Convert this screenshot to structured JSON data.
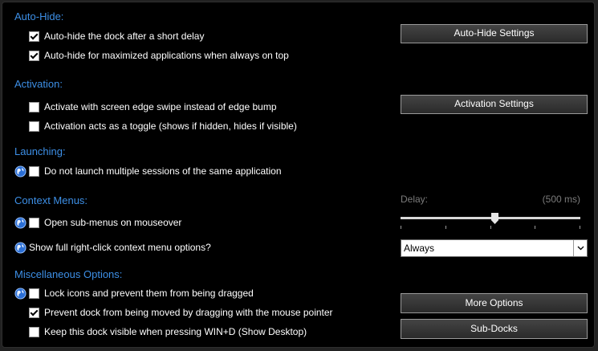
{
  "colors": {
    "accent": "#3d8fe6",
    "background": "#000000"
  },
  "autohide": {
    "title": "Auto-Hide:",
    "options": [
      {
        "label": "Auto-hide the dock after a short delay",
        "checked": true
      },
      {
        "label": "Auto-hide for maximized applications when always on top",
        "checked": true
      }
    ],
    "button": "Auto-Hide Settings"
  },
  "activation": {
    "title": "Activation:",
    "options": [
      {
        "label": "Activate with screen edge swipe instead of edge bump",
        "checked": false
      },
      {
        "label": "Activation acts as a toggle (shows if hidden, hides if visible)",
        "checked": false
      }
    ],
    "button": "Activation Settings"
  },
  "launching": {
    "title": "Launching:",
    "options": [
      {
        "label": "Do not launch multiple sessions of the same application",
        "checked": false,
        "icon": "globe-icon"
      }
    ]
  },
  "context": {
    "title": "Context Menus:",
    "options": [
      {
        "label": "Open sub-menus on mouseover",
        "checked": false,
        "icon": "globe-icon"
      }
    ],
    "show_full_label": "Show full right-click context menu options?",
    "delay_label": "Delay:",
    "delay_value": "(500 ms)",
    "slider_fraction": 0.5,
    "dropdown_value": "Always"
  },
  "misc": {
    "title": "Miscellaneous Options:",
    "options": [
      {
        "label": "Lock icons and prevent them from being dragged",
        "checked": false,
        "icon": "globe-icon"
      },
      {
        "label": "Prevent dock from being moved by dragging with the mouse pointer",
        "checked": true
      },
      {
        "label": "Keep this dock visible when pressing WIN+D (Show Desktop)",
        "checked": false
      }
    ],
    "more_button": "More Options",
    "subdocks_button": "Sub-Docks"
  }
}
